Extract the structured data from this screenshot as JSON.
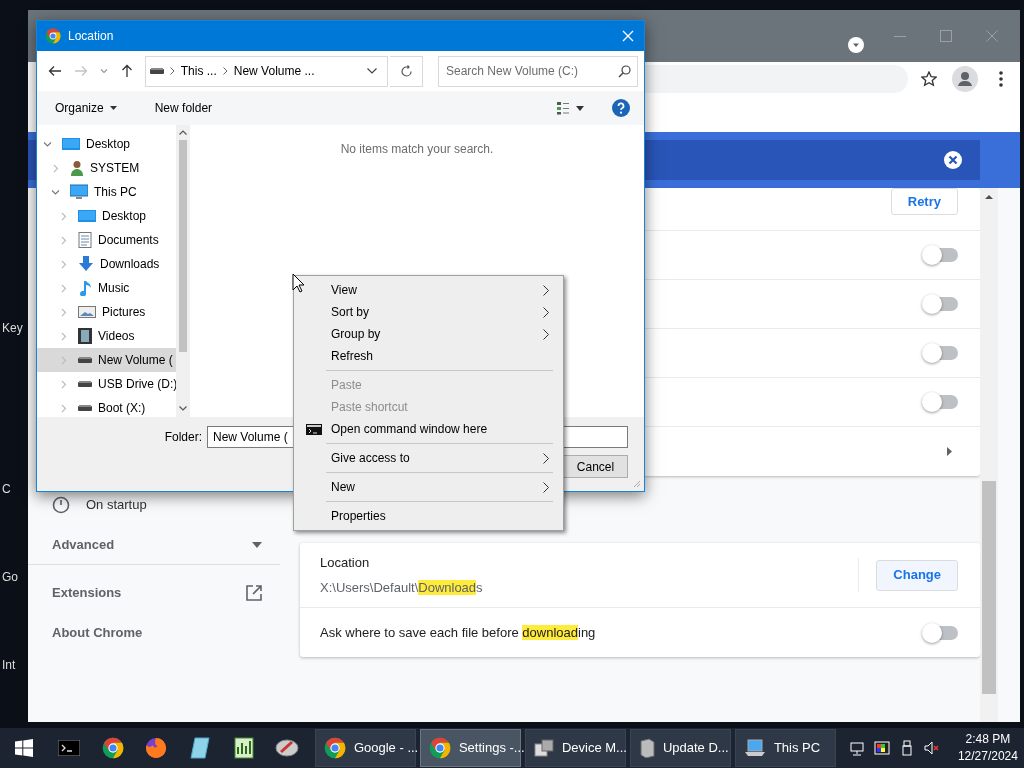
{
  "desktop": {
    "labels": [
      "Key",
      "C",
      "Go",
      "Int"
    ]
  },
  "browser": {
    "card_rows": [
      {
        "kind": "button",
        "label": "Retry"
      },
      {
        "kind": "toggle",
        "on": false
      },
      {
        "kind": "toggle",
        "on": false
      },
      {
        "kind": "toggle",
        "on": false
      },
      {
        "kind": "toggle",
        "on": false
      },
      {
        "kind": "arrow"
      }
    ],
    "sidebar": [
      {
        "kind": "startup",
        "label": "On startup"
      },
      {
        "kind": "expander",
        "label": "Advanced",
        "expanded": false
      },
      {
        "kind": "external",
        "label": "Extensions"
      },
      {
        "kind": "plain",
        "label": "About Chrome"
      }
    ],
    "location": {
      "label": "Location",
      "path": [
        {
          "text": "X:\\Users\\Default\\",
          "highlighted": false
        },
        {
          "text": "Download",
          "highlighted": true
        },
        {
          "text": "s",
          "highlighted": false
        }
      ],
      "button": "Change"
    },
    "ask_row": {
      "text": [
        {
          "text": "Ask where to save each file before ",
          "highlighted": false
        },
        {
          "text": "download",
          "highlighted": true
        },
        {
          "text": "ing",
          "highlighted": false
        }
      ],
      "on": false
    }
  },
  "dialog": {
    "title": "Location",
    "breadcrumbs": [
      "This ...",
      "New Volume ..."
    ],
    "search": {
      "placeholder": "Search New Volume (C:)"
    },
    "toolbar": [
      "Organize",
      "New folder"
    ],
    "tree": [
      {
        "label": "Desktop",
        "kind": "desktop",
        "expanded": true,
        "selected": false,
        "children": [
          {
            "label": "SYSTEM",
            "kind": "user",
            "expanded": false,
            "selected": false
          },
          {
            "label": "This PC",
            "kind": "pc",
            "expanded": true,
            "selected": false,
            "children": [
              {
                "label": "Desktop",
                "kind": "desktop",
                "expanded": false,
                "selected": false
              },
              {
                "label": "Documents",
                "kind": "documents",
                "expanded": false,
                "selected": false
              },
              {
                "label": "Downloads",
                "kind": "downloads",
                "expanded": false,
                "selected": false
              },
              {
                "label": "Music",
                "kind": "music",
                "expanded": false,
                "selected": false
              },
              {
                "label": "Pictures",
                "kind": "pictures",
                "expanded": false,
                "selected": false
              },
              {
                "label": "Videos",
                "kind": "videos",
                "expanded": false,
                "selected": false
              },
              {
                "label": "New Volume (",
                "kind": "drive",
                "expanded": false,
                "selected": true
              },
              {
                "label": "USB Drive (D:)",
                "kind": "drive",
                "expanded": false,
                "selected": false
              },
              {
                "label": "Boot (X:)",
                "kind": "drive",
                "expanded": false,
                "selected": false
              }
            ]
          }
        ]
      }
    ],
    "empty_message": "No items match your search.",
    "folder_label": "Folder:",
    "folder_value": "New Volume (",
    "cancel": "Cancel"
  },
  "context_menu": {
    "items": [
      {
        "kind": "item",
        "label": "View",
        "submenu": true,
        "disabled": false
      },
      {
        "kind": "item",
        "label": "Sort by",
        "submenu": true,
        "disabled": false
      },
      {
        "kind": "item",
        "label": "Group by",
        "submenu": true,
        "disabled": false
      },
      {
        "kind": "item",
        "label": "Refresh",
        "submenu": false,
        "disabled": false
      },
      {
        "kind": "separator"
      },
      {
        "kind": "item",
        "label": "Paste",
        "submenu": false,
        "disabled": true
      },
      {
        "kind": "item",
        "label": "Paste shortcut",
        "submenu": false,
        "disabled": true
      },
      {
        "kind": "icon-item",
        "label": "Open command window here",
        "submenu": false,
        "disabled": false
      },
      {
        "kind": "separator"
      },
      {
        "kind": "item",
        "label": "Give access to",
        "submenu": true,
        "disabled": false
      },
      {
        "kind": "separator"
      },
      {
        "kind": "item",
        "label": "New",
        "submenu": true,
        "disabled": false
      },
      {
        "kind": "separator"
      },
      {
        "kind": "item",
        "label": "Properties",
        "submenu": false,
        "disabled": false
      }
    ]
  },
  "taskbar": {
    "pinned": [
      {
        "kind": "terminal"
      },
      {
        "kind": "chrome"
      },
      {
        "kind": "firefox"
      },
      {
        "kind": "glass"
      },
      {
        "kind": "chart"
      },
      {
        "kind": "tool"
      }
    ],
    "buttons": [
      {
        "label": "Google - ...",
        "kind": "chrome",
        "selected": false
      },
      {
        "label": "Settings -...",
        "kind": "chrome",
        "selected": true
      },
      {
        "label": "Device M...",
        "kind": "device",
        "selected": false
      },
      {
        "label": "Update D...",
        "kind": "box",
        "selected": false
      },
      {
        "label": "This PC",
        "kind": "pc",
        "selected": false
      }
    ],
    "time": "2:48 PM",
    "date": "12/27/2024"
  }
}
